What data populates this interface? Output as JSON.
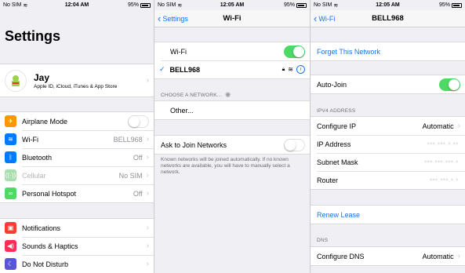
{
  "colors": {
    "accent": "#1a73e8",
    "toggle_on": "#4cd964"
  },
  "settings": {
    "status": {
      "carrier": "No SIM",
      "time": "12:04 AM",
      "battery": "95%"
    },
    "title": "Settings",
    "profile": {
      "name": "Jay",
      "subtitle": "Apple ID, iCloud, iTunes & App Store"
    },
    "rows": [
      {
        "label": "Airplane Mode",
        "icon": "airplane-icon",
        "color": "#ff9500"
      },
      {
        "label": "Wi-Fi",
        "value": "BELL968",
        "icon": "wifi-icon",
        "color": "#007aff"
      },
      {
        "label": "Bluetooth",
        "value": "Off",
        "icon": "bluetooth-icon",
        "color": "#007aff"
      },
      {
        "label": "Cellular",
        "value": "No SIM",
        "icon": "cellular-icon",
        "color": "#4cd964"
      },
      {
        "label": "Personal Hotspot",
        "value": "Off",
        "icon": "hotspot-icon",
        "color": "#4cd964"
      }
    ],
    "rows2": [
      {
        "label": "Notifications",
        "icon": "notifications-icon",
        "color": "#ff3b30"
      },
      {
        "label": "Sounds & Haptics",
        "icon": "sounds-icon",
        "color": "#ff2d55"
      },
      {
        "label": "Do Not Disturb",
        "icon": "moon-icon",
        "color": "#5856d6"
      }
    ]
  },
  "wifi": {
    "status": {
      "carrier": "No SIM",
      "time": "12:05 AM",
      "battery": "95%"
    },
    "back": "Settings",
    "title": "Wi-Fi",
    "wifi_label": "Wi-Fi",
    "network": "BELL968",
    "choose_header": "CHOOSE A NETWORK...",
    "other": "Other...",
    "ask_label": "Ask to Join Networks",
    "ask_footnote": "Known networks will be joined automatically. If no known networks are available, you will have to manually select a network."
  },
  "network": {
    "status": {
      "carrier": "No SIM",
      "time": "12:05 AM",
      "battery": "95%"
    },
    "back": "Wi-Fi",
    "title": "BELL968",
    "forget": "Forget This Network",
    "auto_join": "Auto-Join",
    "ipv4_header": "IPV4 ADDRESS",
    "configure_ip_label": "Configure IP",
    "configure_ip_value": "Automatic",
    "ip_label": "IP Address",
    "subnet_label": "Subnet Mask",
    "router_label": "Router",
    "renew": "Renew Lease",
    "dns_header": "DNS",
    "dns_label": "Configure DNS",
    "dns_value": "Automatic"
  }
}
